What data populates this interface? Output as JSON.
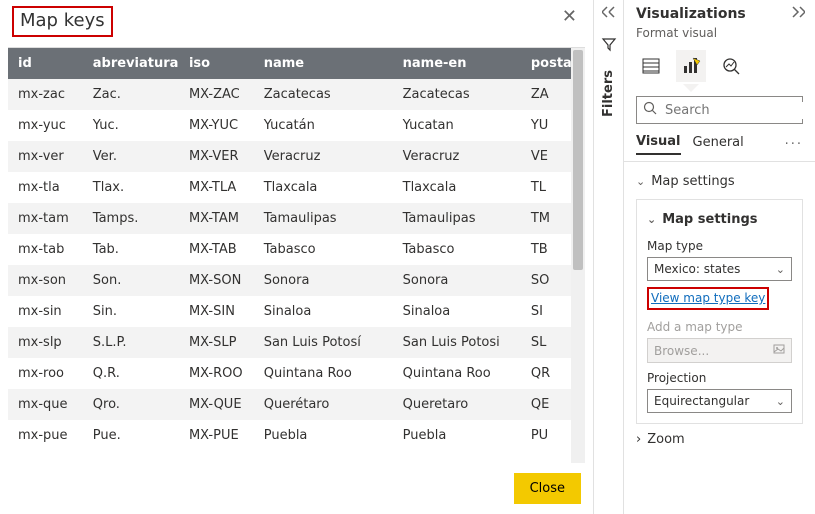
{
  "dialog": {
    "title": "Map keys",
    "close_btn": "Close",
    "columns": [
      "id",
      "abreviatura",
      "iso",
      "name",
      "name-en",
      "postal"
    ],
    "rows": [
      {
        "id": "mx-zac",
        "ab": "Zac.",
        "iso": "MX-ZAC",
        "name": "Zacatecas",
        "nameen": "Zacatecas",
        "postal": "ZA"
      },
      {
        "id": "mx-yuc",
        "ab": "Yuc.",
        "iso": "MX-YUC",
        "name": "Yucatán",
        "nameen": "Yucatan",
        "postal": "YU"
      },
      {
        "id": "mx-ver",
        "ab": "Ver.",
        "iso": "MX-VER",
        "name": "Veracruz",
        "nameen": "Veracruz",
        "postal": "VE"
      },
      {
        "id": "mx-tla",
        "ab": "Tlax.",
        "iso": "MX-TLA",
        "name": "Tlaxcala",
        "nameen": "Tlaxcala",
        "postal": "TL"
      },
      {
        "id": "mx-tam",
        "ab": "Tamps.",
        "iso": "MX-TAM",
        "name": "Tamaulipas",
        "nameen": "Tamaulipas",
        "postal": "TM"
      },
      {
        "id": "mx-tab",
        "ab": "Tab.",
        "iso": "MX-TAB",
        "name": "Tabasco",
        "nameen": "Tabasco",
        "postal": "TB"
      },
      {
        "id": "mx-son",
        "ab": "Son.",
        "iso": "MX-SON",
        "name": "Sonora",
        "nameen": "Sonora",
        "postal": "SO"
      },
      {
        "id": "mx-sin",
        "ab": "Sin.",
        "iso": "MX-SIN",
        "name": "Sinaloa",
        "nameen": "Sinaloa",
        "postal": "SI"
      },
      {
        "id": "mx-slp",
        "ab": "S.L.P.",
        "iso": "MX-SLP",
        "name": "San Luis Potosí",
        "nameen": "San Luis Potosi",
        "postal": "SL"
      },
      {
        "id": "mx-roo",
        "ab": "Q.R.",
        "iso": "MX-ROO",
        "name": "Quintana Roo",
        "nameen": "Quintana Roo",
        "postal": "QR"
      },
      {
        "id": "mx-que",
        "ab": "Qro.",
        "iso": "MX-QUE",
        "name": "Querétaro",
        "nameen": "Queretaro",
        "postal": "QE"
      },
      {
        "id": "mx-pue",
        "ab": "Pue.",
        "iso": "MX-PUE",
        "name": "Puebla",
        "nameen": "Puebla",
        "postal": "PU"
      }
    ]
  },
  "filters": {
    "label": "Filters"
  },
  "vis": {
    "title": "Visualizations",
    "sub": "Format visual",
    "search_placeholder": "Search",
    "tabs": {
      "visual": "Visual",
      "general": "General"
    },
    "mapsettings_label": "Map settings",
    "maptype_label": "Map type",
    "maptype_value": "Mexico: states",
    "view_key": "View map type key",
    "add_map": "Add a map type",
    "browse": "Browse...",
    "projection_label": "Projection",
    "projection_value": "Equirectangular",
    "zoom": "Zoom"
  }
}
